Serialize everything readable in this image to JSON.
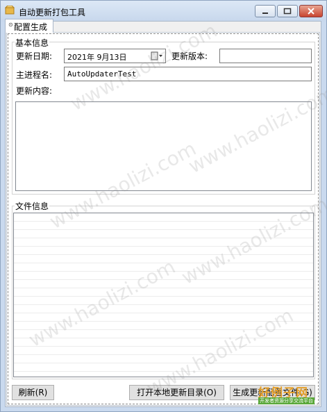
{
  "window": {
    "title": "自动更新打包工具"
  },
  "tab": {
    "label": "配置生成"
  },
  "basic_info": {
    "group_title": "基本信息",
    "update_date_label": "更新日期:",
    "update_date_value": "2021年  9月13日",
    "update_version_label": "更新版本:",
    "update_version_value": "",
    "main_process_label": "主进程名:",
    "main_process_value": "AutoUpdaterTest",
    "update_content_label": "更新内容:",
    "update_content_value": ""
  },
  "file_info": {
    "group_title": "文件信息"
  },
  "buttons": {
    "refresh": "刷新(R)",
    "open_dir": "打开本地更新目录(O)",
    "generate": "生成更新配置文件(G)"
  },
  "watermark": {
    "text": "www.haolizi.com",
    "logo_big": "好例子网",
    "logo_small": "开发者资源分享交流平台"
  }
}
